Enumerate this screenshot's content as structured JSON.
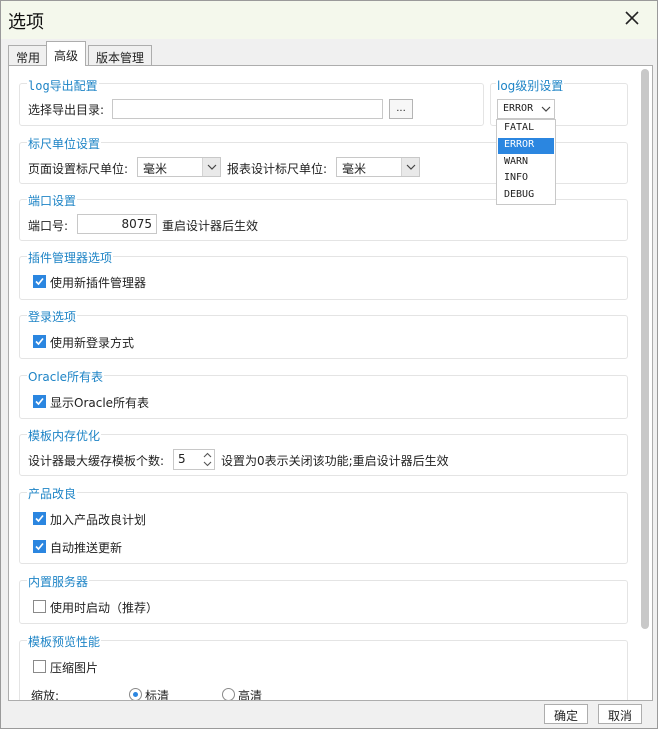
{
  "window": {
    "title": "选项"
  },
  "tabs": [
    "常用",
    "高级",
    "版本管理"
  ],
  "log_export": {
    "title": "log导出配置",
    "dir_label": "选择导出目录:",
    "dir_value": "",
    "browse_label": "..."
  },
  "log_level": {
    "title": "log级别设置",
    "selected": "ERROR",
    "options": [
      "FATAL",
      "ERROR",
      "WARN",
      "INFO",
      "DEBUG"
    ]
  },
  "ruler": {
    "title": "标尺单位设置",
    "page_label": "页面设置标尺单位:",
    "page_value": "毫米",
    "report_label": "报表设计标尺单位:",
    "report_value": "毫米"
  },
  "port": {
    "title": "端口设置",
    "label": "端口号:",
    "value": "8075",
    "note": "重启设计器后生效"
  },
  "plugin": {
    "title": "插件管理器选项",
    "option": "使用新插件管理器",
    "checked": true
  },
  "login": {
    "title": "登录选项",
    "option": "使用新登录方式",
    "checked": true
  },
  "oracle": {
    "title": "Oracle所有表",
    "option": "显示Oracle所有表",
    "checked": true
  },
  "template_memory": {
    "title": "模板内存优化",
    "label": "设计器最大缓存模板个数:",
    "value": "5",
    "note": "设置为0表示关闭该功能;重启设计器后生效"
  },
  "improvement": {
    "title": "产品改良",
    "options": [
      {
        "label": "加入产品改良计划",
        "checked": true
      },
      {
        "label": "自动推送更新",
        "checked": true
      }
    ]
  },
  "server": {
    "title": "内置服务器",
    "option": "使用时启动（推荐）",
    "checked": false
  },
  "preview": {
    "title": "模板预览性能",
    "compress_label": "压缩图片",
    "compress_checked": false,
    "zoom_label": "缩放:",
    "zoom_options": [
      "标清",
      "高清"
    ],
    "zoom_selected": "标清"
  },
  "footer": {
    "ok": "确定",
    "cancel": "取消"
  },
  "colors": {
    "accent": "#2b86e0",
    "section_title": "#1e84c6"
  }
}
